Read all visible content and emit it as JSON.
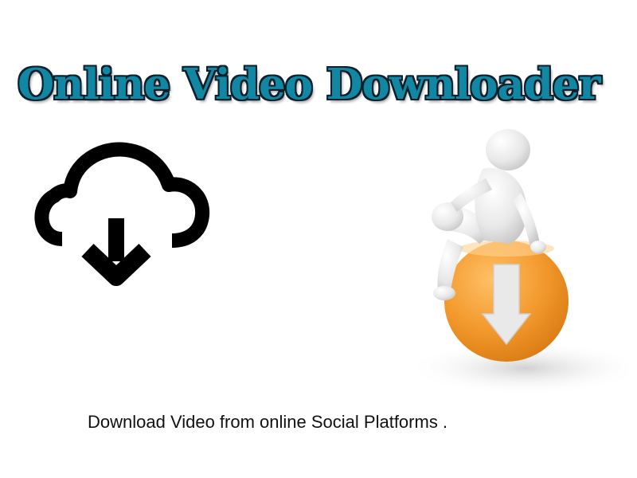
{
  "title": "Online Video Downloader",
  "caption": "Download Video from online Social Platforms .",
  "icons": {
    "cloud": "cloud-download-icon",
    "mascot": "figure-on-download-button"
  },
  "colors": {
    "title_fill": "#1187a3",
    "title_outline": "#0d1f2a",
    "orange_button": "#f0a036",
    "icon_black": "#000000"
  }
}
